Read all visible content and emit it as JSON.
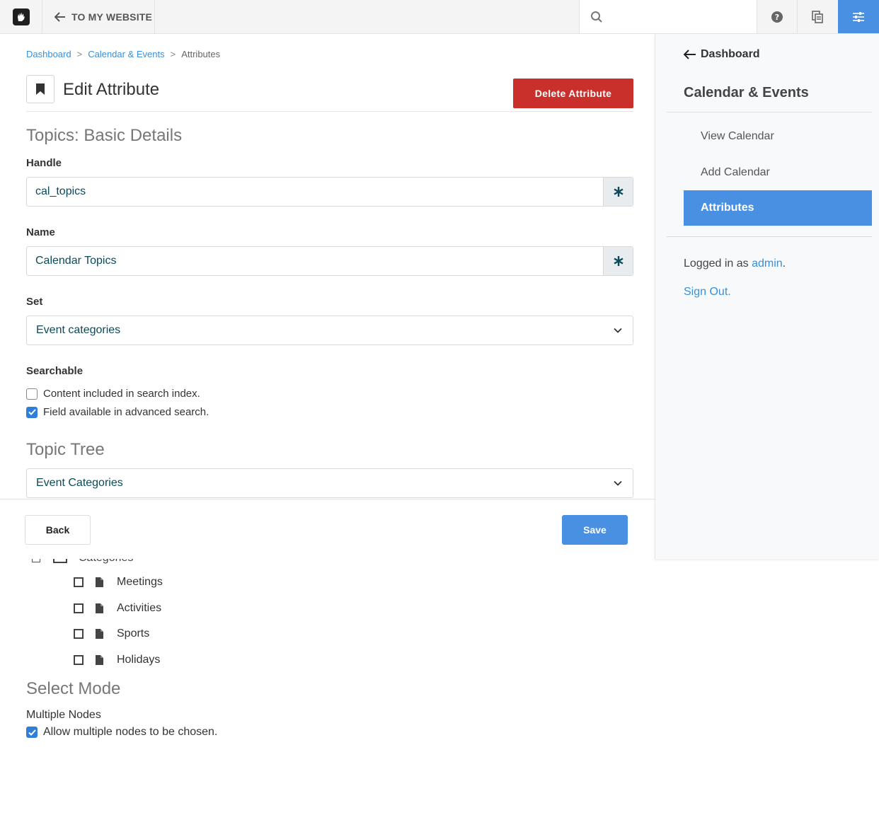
{
  "toolbar": {
    "back_label": "TO MY WEBSITE",
    "search_placeholder": "",
    "accent_color": "#4a90e2"
  },
  "breadcrumb": [
    "Dashboard",
    "Calendar & Events",
    "Attributes"
  ],
  "page": {
    "title": "Edit Attribute",
    "delete_label": "Delete Attribute"
  },
  "basic": {
    "heading": "Topics: Basic Details",
    "handle_label": "Handle",
    "handle_value": "cal_topics",
    "name_label": "Name",
    "name_value": "Calendar Topics",
    "set_label": "Set",
    "set_value": "Event categories",
    "searchable_label": "Searchable",
    "search_index_label": "Content included in search index.",
    "search_index_checked": false,
    "advanced_label": "Field available in advanced search.",
    "advanced_checked": true
  },
  "topic_tree": {
    "heading": "Topic Tree",
    "tree_value": "Event Categories",
    "root_label": "Categories",
    "items": [
      "Meetings",
      "Activities",
      "Sports",
      "Holidays"
    ]
  },
  "select_mode": {
    "heading": "Select Mode",
    "multiple_label": "Multiple Nodes",
    "allow_label": "Allow multiple nodes to be chosen.",
    "allow_checked": true
  },
  "footer": {
    "back_label": "Back",
    "save_label": "Save"
  },
  "sidebar": {
    "back_label": "Dashboard",
    "section": "Calendar & Events",
    "items": [
      {
        "label": "View Calendar",
        "active": false
      },
      {
        "label": "Add Calendar",
        "active": false
      },
      {
        "label": "Attributes",
        "active": true
      }
    ],
    "logged_prefix": "Logged in as",
    "user": "admin",
    "logged_suffix": ".",
    "signout": "Sign Out."
  }
}
